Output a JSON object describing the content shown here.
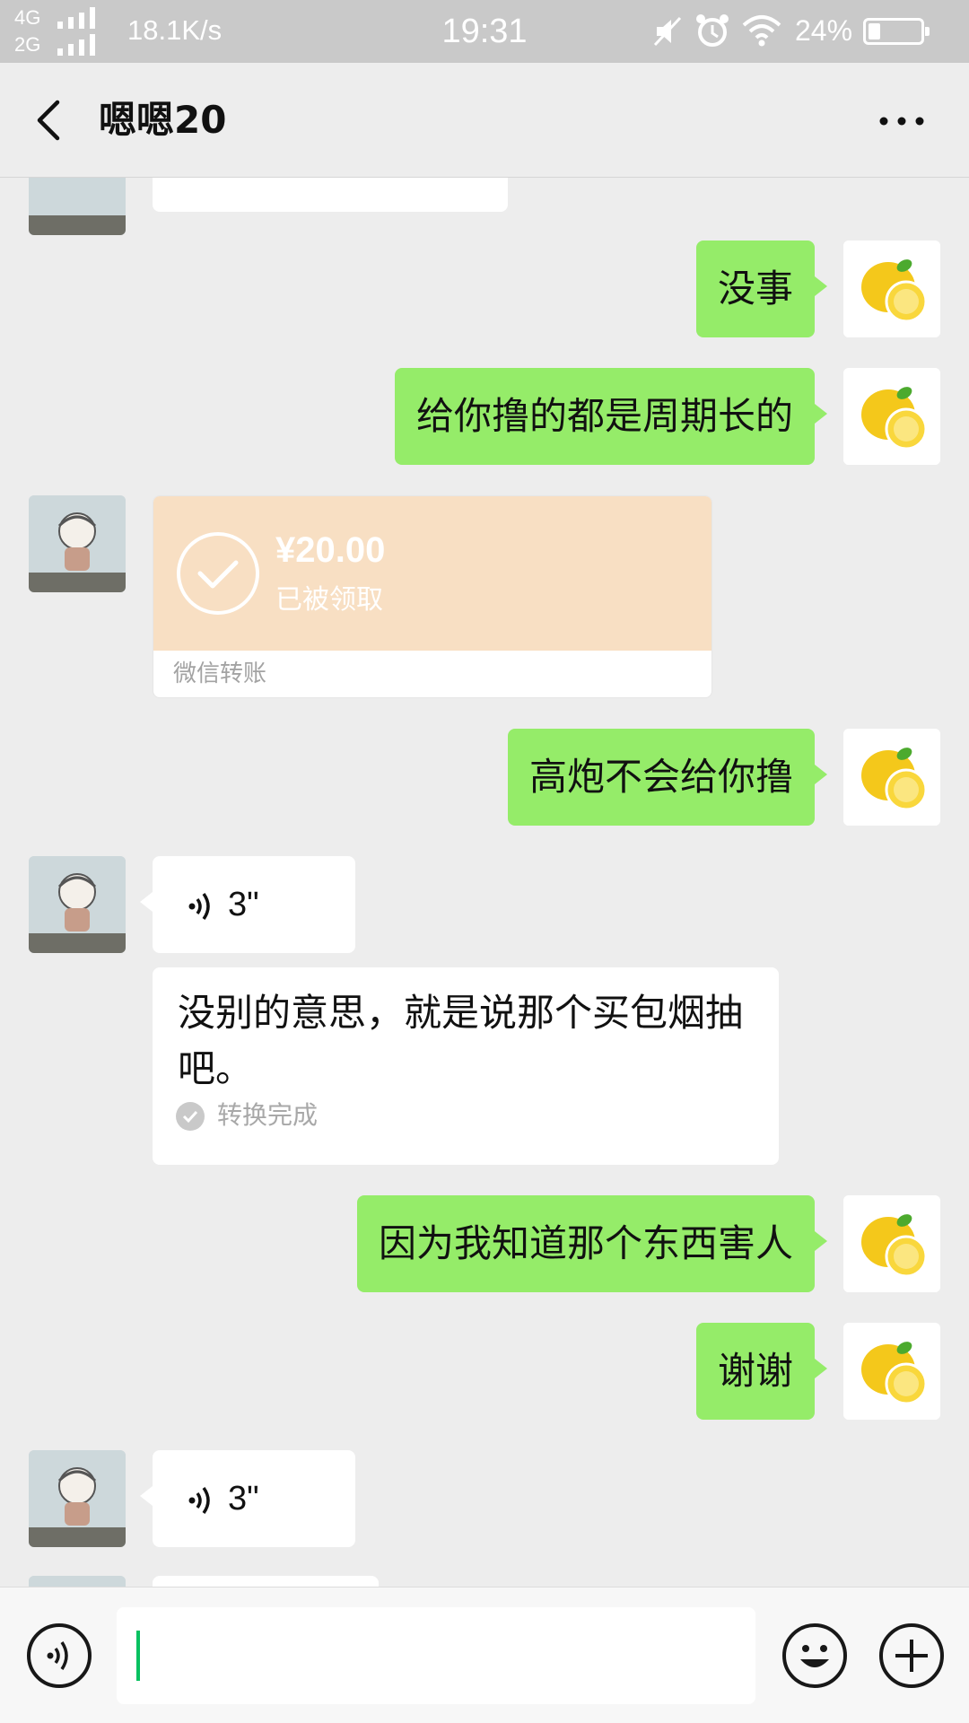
{
  "status_bar": {
    "network_top": "4G",
    "network_bottom": "2G",
    "speed": "18.1K/s",
    "time": "19:31",
    "battery_percent": "24%",
    "battery_level": 0.24
  },
  "header": {
    "title": "嗯嗯20",
    "back_icon": "chevron-left-icon",
    "more_icon": "more-dots-icon"
  },
  "messages": [
    {
      "from": "me",
      "type": "text",
      "text": "没事"
    },
    {
      "from": "me",
      "type": "text",
      "text": "给你撸的都是周期长的"
    },
    {
      "from": "them",
      "type": "transfer",
      "amount": "¥20.00",
      "state": "已被领取",
      "footer": "微信转账"
    },
    {
      "from": "me",
      "type": "text",
      "text": "高炮不会给你撸"
    },
    {
      "from": "them",
      "type": "voice",
      "duration": "3\"",
      "transcript": "没别的意思，就是说那个买包烟抽吧。",
      "transcript_status": "转换完成"
    },
    {
      "from": "me",
      "type": "text",
      "text": "因为我知道那个东西害人"
    },
    {
      "from": "me",
      "type": "text",
      "text": "谢谢"
    },
    {
      "from": "them",
      "type": "voice",
      "duration": "3\""
    }
  ],
  "input_bar": {
    "voice_icon": "voice-input-icon",
    "emoji_icon": "emoji-icon",
    "plus_icon": "plus-icon",
    "value": ""
  },
  "colors": {
    "my_bubble": "#95ec69",
    "their_bubble": "#ffffff",
    "transfer_bg": "#f8dfc3",
    "background": "#ededed",
    "caret": "#07c160"
  }
}
